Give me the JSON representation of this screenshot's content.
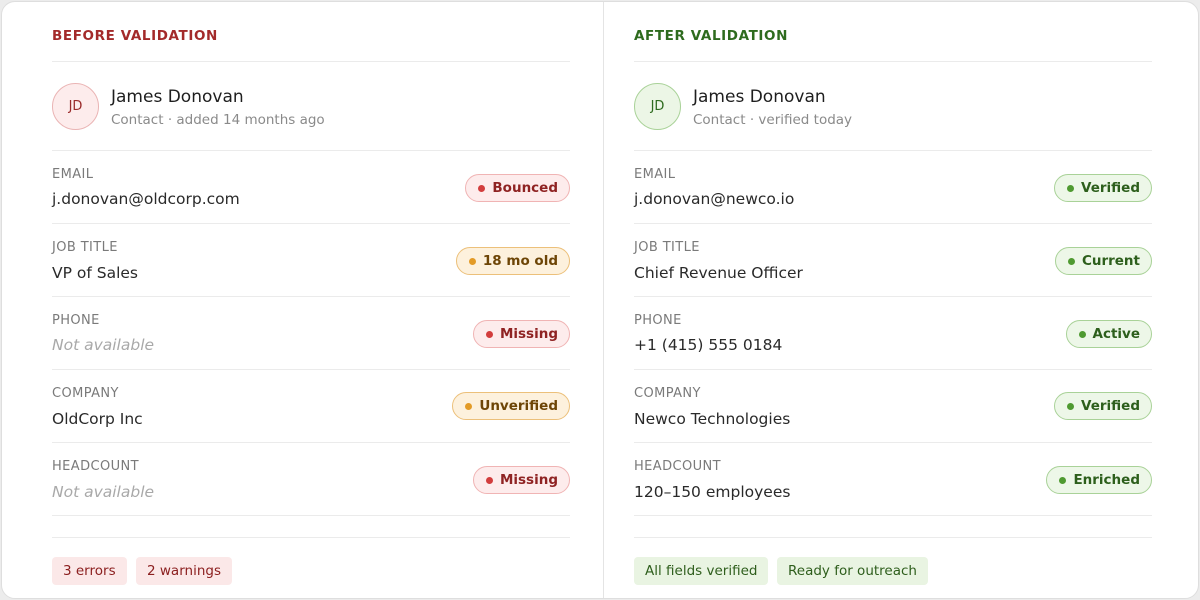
{
  "before": {
    "section_title": "BEFORE VALIDATION",
    "contact": {
      "initials": "JD",
      "name": "James Donovan",
      "subtitle": "Contact · added 14 months ago"
    },
    "fields": [
      {
        "label": "EMAIL",
        "value": "j.donovan@oldcorp.com",
        "status": "Bounced",
        "status_type": "error"
      },
      {
        "label": "JOB TITLE",
        "value": "VP of Sales",
        "status": "18 mo old",
        "status_type": "warning"
      },
      {
        "label": "PHONE",
        "value": "Not available",
        "status": "Missing",
        "status_type": "error"
      },
      {
        "label": "COMPANY",
        "value": "OldCorp Inc",
        "status": "Unverified",
        "status_type": "warning"
      },
      {
        "label": "HEADCOUNT",
        "value": "Not available",
        "status": "Missing",
        "status_type": "error"
      }
    ],
    "summary": [
      "3 errors",
      "2 warnings"
    ]
  },
  "after": {
    "section_title": "AFTER VALIDATION",
    "contact": {
      "initials": "JD",
      "name": "James Donovan",
      "subtitle": "Contact · verified today"
    },
    "fields": [
      {
        "label": "EMAIL",
        "value": "j.donovan@newco.io",
        "status": "Verified",
        "status_type": "success"
      },
      {
        "label": "JOB TITLE",
        "value": "Chief Revenue Officer",
        "status": "Current",
        "status_type": "success"
      },
      {
        "label": "PHONE",
        "value": "+1 (415) 555 0184",
        "status": "Active",
        "status_type": "success"
      },
      {
        "label": "COMPANY",
        "value": "Newco Technologies",
        "status": "Verified",
        "status_type": "success"
      },
      {
        "label": "HEADCOUNT",
        "value": "120–150 employees",
        "status": "Enriched",
        "status_type": "success"
      }
    ],
    "summary": [
      "All fields verified",
      "Ready for outreach"
    ]
  },
  "colors": {
    "error": "#d23d3d",
    "warning": "#e39b27",
    "success": "#4f9a31",
    "before_title": "#a32a2a",
    "after_title": "#2e6b1e"
  }
}
